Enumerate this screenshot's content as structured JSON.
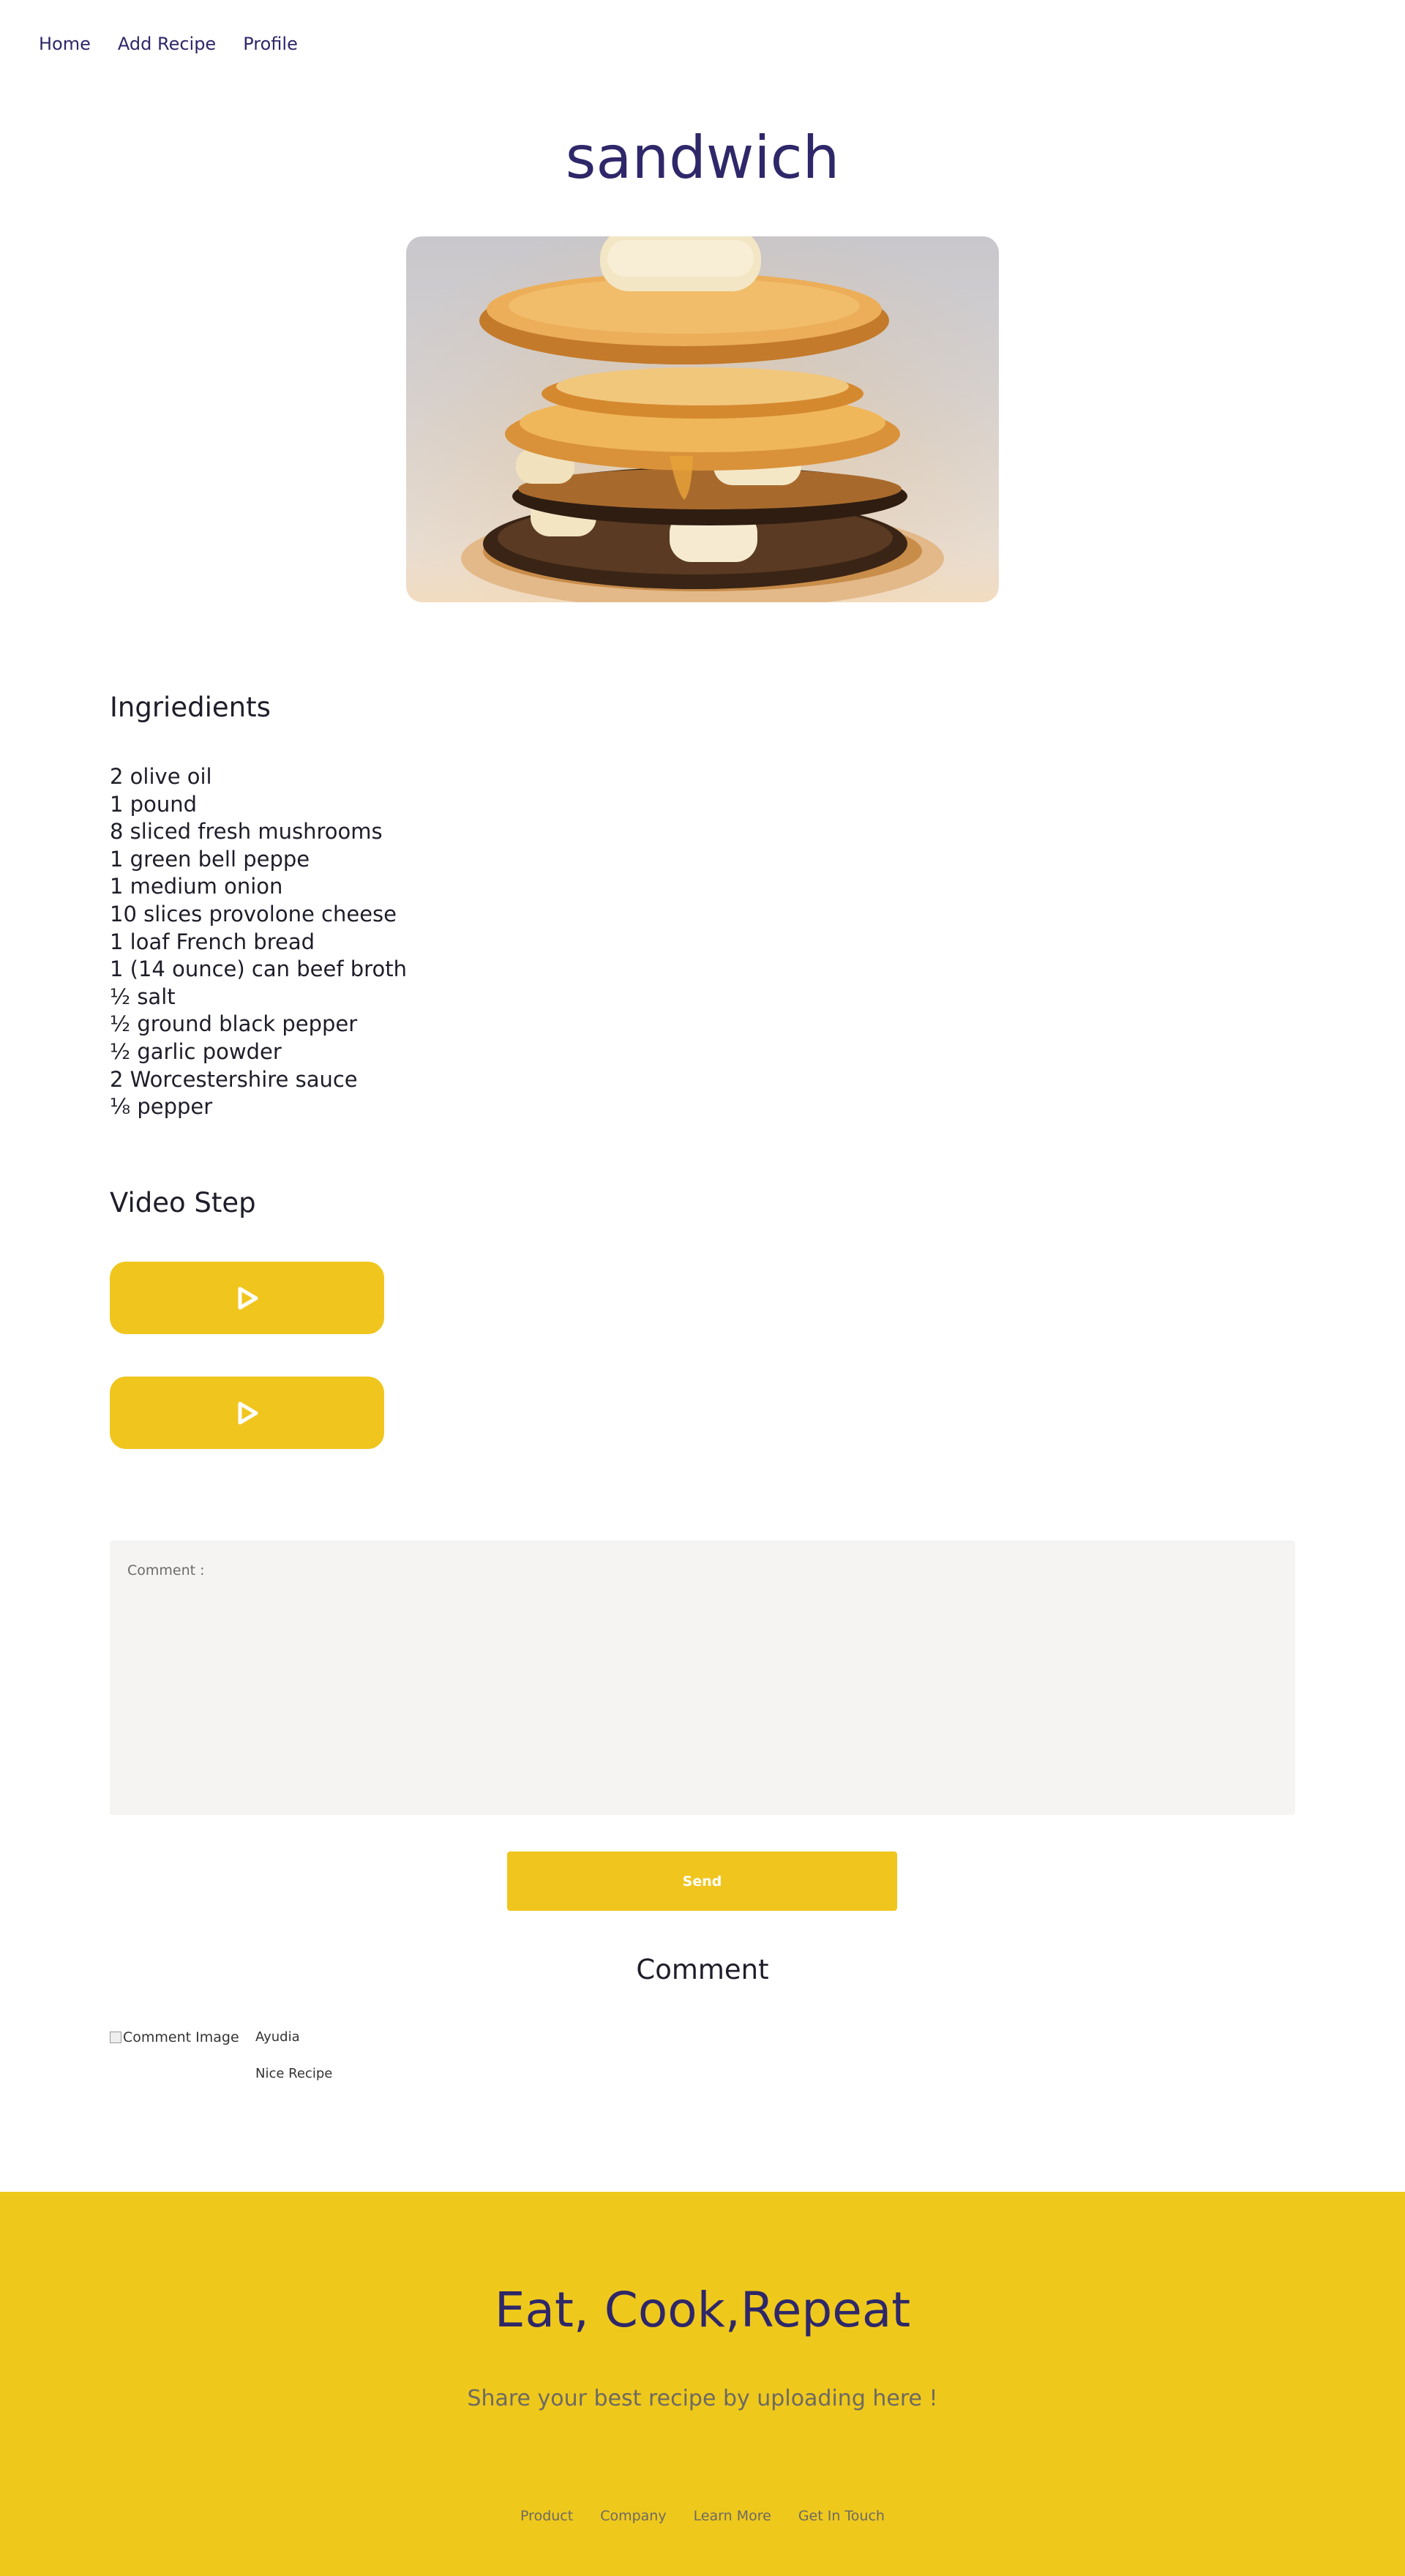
{
  "nav": {
    "items": [
      "Home",
      "Add Recipe",
      "Profile"
    ]
  },
  "recipe": {
    "title": "sandwich",
    "ingredients_heading": "Ingriedients",
    "ingredients": [
      "2 olive oil",
      "1 pound",
      "8 sliced fresh mushrooms",
      "1 green bell peppe",
      "1 medium onion",
      "10 slices provolone cheese",
      "1 loaf French bread",
      "1 (14 ounce) can beef broth",
      "½ salt",
      "½ ground black pepper",
      "½ garlic powder",
      "2 Worcestershire sauce",
      "⅛ pepper"
    ],
    "video_heading": "Video Step",
    "video_icon": "play-icon"
  },
  "comment_form": {
    "placeholder": "Comment :",
    "send_label": "Send"
  },
  "comments": {
    "heading": "Comment",
    "items": [
      {
        "image_alt": "Comment Image",
        "user": "Ayudia",
        "text": "Nice Recipe"
      }
    ]
  },
  "footer": {
    "title": "Eat, Cook,Repeat",
    "subtitle": "Share your best recipe by uploading here !",
    "links": [
      "Product",
      "Company",
      "Learn More",
      "Get In Touch"
    ]
  },
  "colors": {
    "primary": "#2e2769",
    "accent": "#f0c61e",
    "footer_bg": "#efc81c",
    "comment_bg": "#f5f4f2"
  }
}
